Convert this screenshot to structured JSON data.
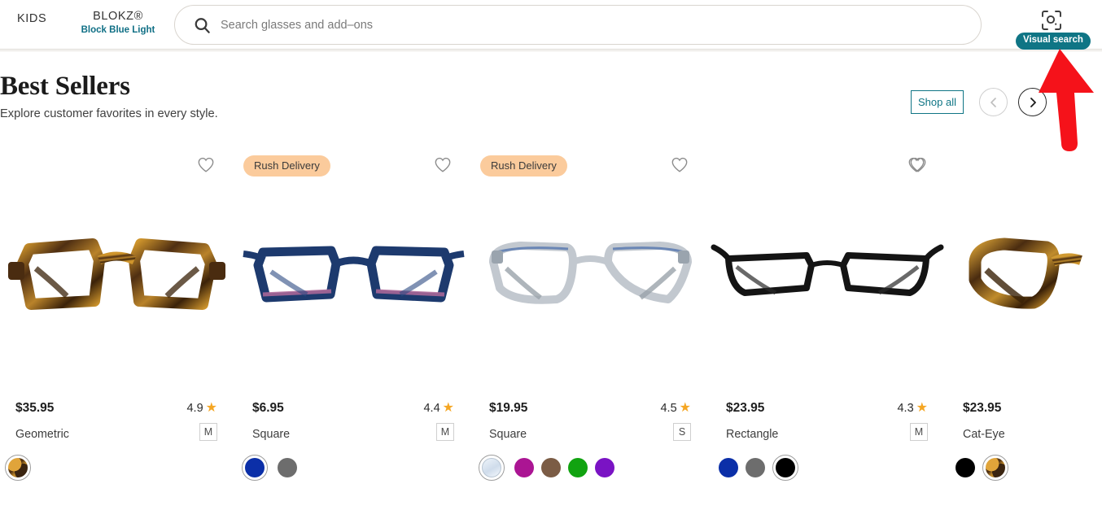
{
  "nav": {
    "kids_label": "KIDS",
    "blokz_label": "BLOKZ®",
    "blokz_sub": "Block Blue Light",
    "search_placeholder": "Search glasses and add–ons",
    "search_value": "",
    "search_icon": "search-icon",
    "visual_search_icon": "visual-search-icon",
    "visual_search_label": "Visual search",
    "visual_search_color": "#0f7585"
  },
  "section": {
    "title": "Best Sellers",
    "subtitle": "Explore customer favorites in every style.",
    "shop_all_label": "Shop all",
    "shop_all_color": "#0f7585",
    "prev_icon": "chevron-left-icon",
    "next_icon": "chevron-right-icon"
  },
  "badges": {
    "rush_delivery": "Rush Delivery",
    "rush_color": "#fbcb9c"
  },
  "products": [
    {
      "badge": "",
      "price": "$35.95",
      "shape": "Geometric",
      "rating": "4.9",
      "size": "M",
      "frame_color": "tortoise",
      "swatches": [
        {
          "name": "tortoise",
          "hex": "tortoise",
          "selected": true
        }
      ]
    },
    {
      "badge": "Rush Delivery",
      "price": "$6.95",
      "shape": "Square",
      "rating": "4.4",
      "size": "M",
      "frame_color": "blue",
      "swatches": [
        {
          "name": "blue",
          "hex": "#0b2fa8",
          "selected": true
        },
        {
          "name": "grey",
          "hex": "#6d6d6d",
          "selected": false
        }
      ]
    },
    {
      "badge": "Rush Delivery",
      "price": "$19.95",
      "shape": "Square",
      "rating": "4.5",
      "size": "S",
      "frame_color": "clear",
      "swatches": [
        {
          "name": "clear",
          "hex": "clear",
          "selected": true
        },
        {
          "name": "magenta",
          "hex": "#ab1593",
          "selected": false
        },
        {
          "name": "brown",
          "hex": "#7b5c45",
          "selected": false
        },
        {
          "name": "green",
          "hex": "#11a310",
          "selected": false
        },
        {
          "name": "purple",
          "hex": "#7a13c4",
          "selected": false
        }
      ]
    },
    {
      "badge": "",
      "price": "$23.95",
      "shape": "Rectangle",
      "rating": "4.3",
      "size": "M",
      "frame_color": "black",
      "swatches": [
        {
          "name": "blue",
          "hex": "#0b2fa8",
          "selected": false
        },
        {
          "name": "grey",
          "hex": "#6d6d6d",
          "selected": false
        },
        {
          "name": "black",
          "hex": "#000000",
          "selected": true
        }
      ]
    },
    {
      "badge": "",
      "price": "$23.95",
      "shape": "Cat-Eye",
      "rating": "",
      "size": "",
      "frame_color": "tortoise",
      "swatches": [
        {
          "name": "black",
          "hex": "#000000",
          "selected": false
        },
        {
          "name": "tortoise",
          "hex": "tortoise",
          "selected": true
        }
      ]
    }
  ],
  "annotation": {
    "arrow_icon": "red-arrow-up-icon",
    "arrow_color": "#f5121a"
  },
  "icons": {
    "heart": "heart-outline-icon",
    "star": "★"
  }
}
